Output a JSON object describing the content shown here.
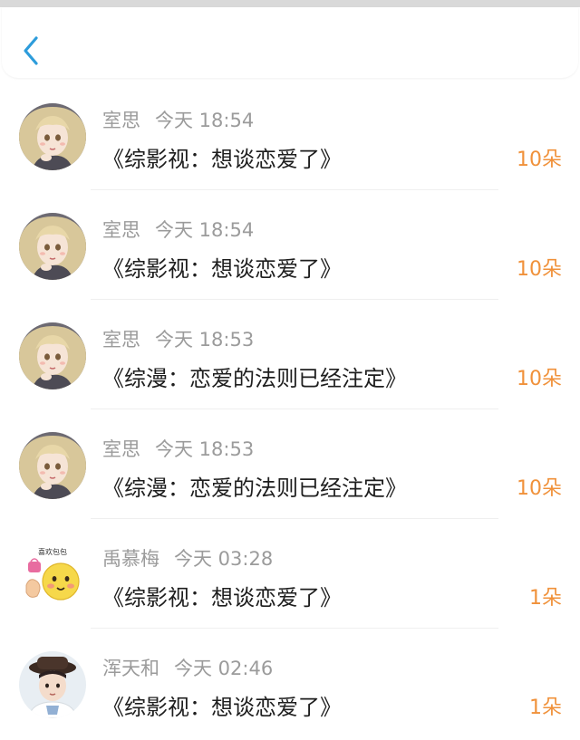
{
  "header": {
    "back_icon": "chevron-left-icon",
    "accent_color": "#2d9cdb"
  },
  "colors": {
    "meta_text": "#9b9b9b",
    "title_text": "#1e1e1e",
    "count_text": "#f0913a"
  },
  "entries": [
    {
      "name": "室思",
      "time": "今天 18:54",
      "title": "《综影视：想谈恋爱了》",
      "count": "10朵",
      "avatar": "anime-girl-avatar"
    },
    {
      "name": "室思",
      "time": "今天 18:54",
      "title": "《综影视：想谈恋爱了》",
      "count": "10朵",
      "avatar": "anime-girl-avatar"
    },
    {
      "name": "室思",
      "time": "今天 18:53",
      "title": "《综漫：恋爱的法则已经注定》",
      "count": "10朵",
      "avatar": "anime-girl-avatar"
    },
    {
      "name": "室思",
      "time": "今天 18:53",
      "title": "《综漫：恋爱的法则已经注定》",
      "count": "10朵",
      "avatar": "anime-girl-avatar"
    },
    {
      "name": "禹慕梅",
      "time": "今天 03:28",
      "title": "《综影视：想谈恋爱了》",
      "count": "1朵",
      "avatar": "emoji-sticker-avatar",
      "avatar_caption": "喜欢包包"
    },
    {
      "name": "浑天和",
      "time": "今天 02:46",
      "title": "《综影视：想谈恋爱了》",
      "count": "1朵",
      "avatar": "boy-hat-avatar"
    }
  ]
}
